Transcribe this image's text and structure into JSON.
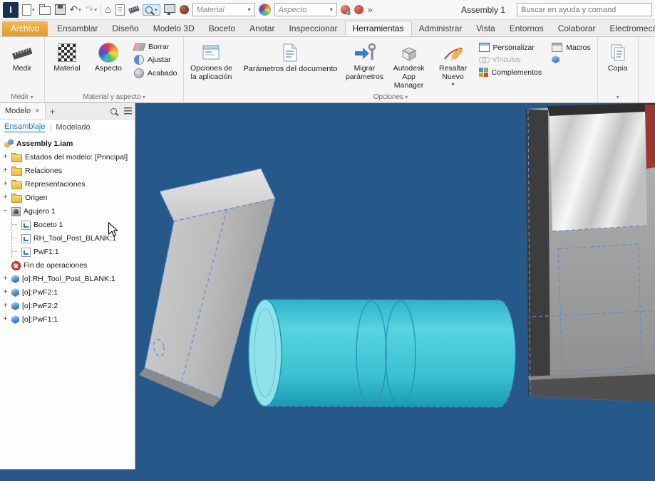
{
  "titlebar": {
    "logo": "I",
    "material_value": "Material",
    "aspecto_value": "Aspecto",
    "doc_title": "Assembly 1",
    "search_placeholder": "Buscar en ayuda y comand"
  },
  "tabs": [
    "Archivo",
    "Ensamblar",
    "Diseño",
    "Modelo 3D",
    "Boceto",
    "Anotar",
    "Inspeccionar",
    "Herramientas",
    "Administrar",
    "Vista",
    "Entornos",
    "Colaborar",
    "Electromecánica"
  ],
  "ribbon": {
    "medir": "Medir",
    "material": "Material",
    "aspecto": "Aspecto",
    "borrar": "Borrar",
    "ajustar": "Ajustar",
    "acabado": "Acabado",
    "opciones_app": "Opciones de la aplicación",
    "parametros_doc": "Parámetros del documento",
    "migrar": "Migrar parámetros",
    "app_manager": "Autodesk App Manager",
    "resaltar": "Resaltar Nuevo",
    "personalizar": "Personalizar",
    "vinculos": "Vínculos",
    "complementos": "Complementos",
    "macros": "Macros",
    "copiar": "Copia",
    "group_medir": "Medir",
    "group_material": "Material y aspecto",
    "group_opciones": "Opciones"
  },
  "browser": {
    "tab": "Modelo",
    "close_glyph": "×",
    "add_glyph": "+",
    "link_ensamblaje": "Ensamblaje",
    "link_sep": "|",
    "link_modelado": "Modelado",
    "tree": [
      {
        "exp": "",
        "label": "Assembly 1.iam"
      },
      {
        "exp": "+",
        "label": "Estados del modelo: [Principal]"
      },
      {
        "exp": "+",
        "label": "Relaciones"
      },
      {
        "exp": "+",
        "label": "Representaciones"
      },
      {
        "exp": "+",
        "label": "Origen"
      },
      {
        "exp": "−",
        "label": "Agujero 1"
      },
      {
        "exp": "",
        "label": "Boceto 1"
      },
      {
        "exp": "",
        "label": "RH_Tool_Post_BLANK:1"
      },
      {
        "exp": "",
        "label": "PwF1:1"
      },
      {
        "exp": "",
        "label": "Fin de operaciones"
      },
      {
        "exp": "+",
        "label": "[o]:RH_Tool_Post_BLANK:1"
      },
      {
        "exp": "+",
        "label": "[o]:PwF2:1"
      },
      {
        "exp": "+",
        "label": "[o]:PwF2:2"
      },
      {
        "exp": "+",
        "label": "[o]:PwF1:1"
      }
    ]
  }
}
